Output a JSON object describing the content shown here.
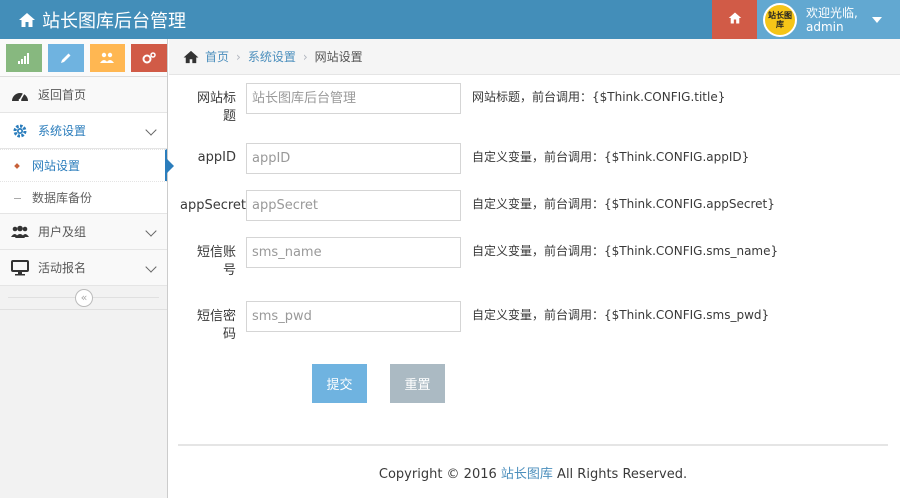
{
  "header": {
    "title": "站长图库后台管理",
    "user_greeting": "欢迎光临,",
    "user_name": "admin",
    "avatar_text": "站长图库"
  },
  "sidebar": {
    "items": [
      {
        "label": "返回首页"
      },
      {
        "label": "系统设置",
        "sub": [
          {
            "label": "网站设置"
          },
          {
            "label": "数据库备份"
          }
        ]
      },
      {
        "label": "用户及组"
      },
      {
        "label": "活动报名"
      }
    ],
    "collapse_glyph": "«"
  },
  "breadcrumb": {
    "home": "首页",
    "section": "系统设置",
    "current": "网站设置"
  },
  "form": {
    "fields": [
      {
        "label": "网站标题",
        "placeholder": "站长图库后台管理",
        "help": "网站标题，前台调用：{$Think.CONFIG.title}"
      },
      {
        "label": "appID",
        "placeholder": "appID",
        "help": "自定义变量，前台调用：{$Think.CONFIG.appID}"
      },
      {
        "label": "appSecret",
        "placeholder": "appSecret",
        "help": "自定义变量，前台调用：{$Think.CONFIG.appSecret}"
      },
      {
        "label": "短信账号",
        "placeholder": "sms_name",
        "help": "自定义变量，前台调用：{$Think.CONFIG.sms_name}"
      },
      {
        "label": "短信密码",
        "placeholder": "sms_pwd",
        "help": "自定义变量，前台调用：{$Think.CONFIG.sms_pwd}"
      }
    ],
    "submit_label": "提交",
    "reset_label": "重置"
  },
  "footer": {
    "prefix": "Copyright © 2016 ",
    "brand": "站长图库",
    "suffix": " All Rights Reserved."
  }
}
